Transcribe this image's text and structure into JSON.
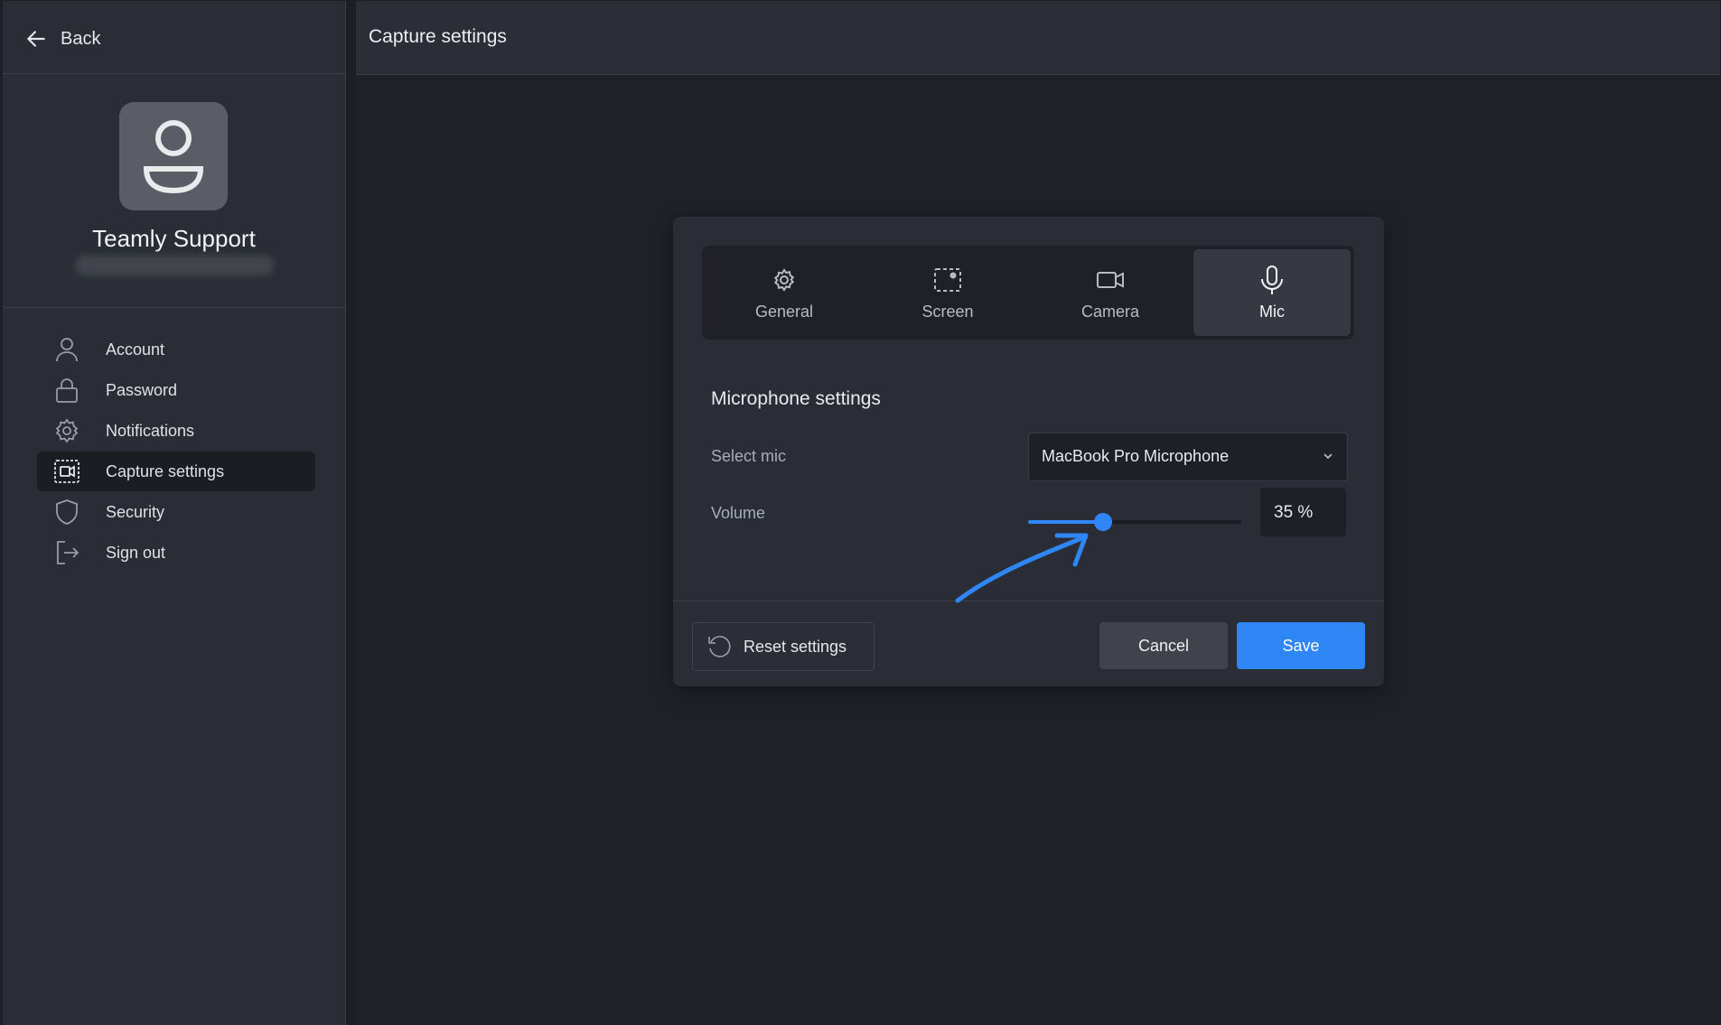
{
  "sidebar": {
    "back_label": "Back",
    "user_name": "Teamly Support",
    "items": [
      {
        "label": "Account",
        "icon": "user-icon"
      },
      {
        "label": "Password",
        "icon": "lock-icon"
      },
      {
        "label": "Notifications",
        "icon": "gear-icon"
      },
      {
        "label": "Capture settings",
        "icon": "capture-icon",
        "active": true
      },
      {
        "label": "Security",
        "icon": "shield-icon"
      },
      {
        "label": "Sign out",
        "icon": "sign-out-icon"
      }
    ]
  },
  "header": {
    "title": "Capture settings"
  },
  "dialog": {
    "tabs": [
      {
        "label": "General",
        "icon": "gear-icon"
      },
      {
        "label": "Screen",
        "icon": "screen-icon"
      },
      {
        "label": "Camera",
        "icon": "camera-icon"
      },
      {
        "label": "Mic",
        "icon": "mic-icon",
        "active": true
      }
    ],
    "section_title": "Microphone settings",
    "select_mic_label": "Select mic",
    "select_mic_value": "MacBook Pro Microphone",
    "volume_label": "Volume",
    "volume_percent": 35,
    "volume_display": "35 %",
    "reset_label": "Reset settings",
    "cancel_label": "Cancel",
    "save_label": "Save"
  },
  "colors": {
    "accent": "#2f86f6",
    "background": "#1f2128",
    "panel": "#2a2d35"
  }
}
